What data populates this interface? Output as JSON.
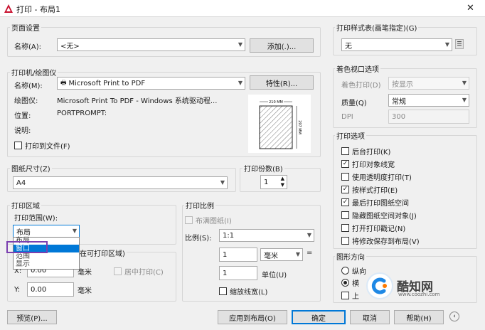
{
  "window": {
    "title": "打印 - 布局1",
    "close": "✕"
  },
  "page_setup": {
    "group_label": "页面设置",
    "name_label": "名称(A):",
    "name_value": "<无>",
    "add_button": "添加(.)..."
  },
  "printer": {
    "group_label": "打印机/绘图仪",
    "name_label": "名称(M):",
    "name_value": "Microsoft Print to PDF",
    "properties_button": "特性(R)...",
    "plotter_label": "绘图仪:",
    "plotter_value": "Microsoft Print To PDF - Windows 系统驱动程...",
    "location_label": "位置:",
    "location_value": "PORTPROMPT:",
    "description_label": "说明:",
    "print_to_file": "打印到文件(F)",
    "preview_width": "210 MM",
    "preview_height": "297 MM"
  },
  "paper_size": {
    "group_label": "图纸尺寸(Z)",
    "value": "A4"
  },
  "copies": {
    "group_label": "打印份数(B)",
    "value": "1"
  },
  "plot_area": {
    "group_label": "打印区域",
    "range_label": "打印范围(W):",
    "range_value": "布局",
    "dropdown_options": [
      "布局",
      "窗口",
      "范围",
      "显示"
    ],
    "selected_option": "窗口"
  },
  "plot_offset": {
    "group_label": "打印偏移(原点设置在可打印区域)",
    "visible_label": "在可打印区域)",
    "x_label": "X:",
    "x_value": "0.00",
    "y_label": "Y:",
    "y_value": "0.00",
    "unit": "毫米",
    "center_label": "居中打印(C)"
  },
  "plot_scale": {
    "group_label": "打印比例",
    "fit_label": "布满图纸(I)",
    "scale_label": "比例(S):",
    "scale_value": "1:1",
    "value1": "1",
    "unit1": "毫米",
    "equals": "=",
    "value2": "1",
    "unit2": "单位(U)",
    "lineweight_label": "缩放线宽(L)"
  },
  "style_table": {
    "group_label": "打印样式表(画笔指定)(G)",
    "value": "无"
  },
  "shaded_viewport": {
    "group_label": "着色视口选项",
    "shade_label": "着色打印(D)",
    "shade_value": "按显示",
    "quality_label": "质量(Q)",
    "quality_value": "常规",
    "dpi_label": "DPI",
    "dpi_value": "300"
  },
  "plot_options": {
    "group_label": "打印选项",
    "items": [
      {
        "label": "后台打印(K)",
        "checked": false
      },
      {
        "label": "打印对象线宽",
        "checked": true
      },
      {
        "label": "使用透明度打印(T)",
        "checked": false
      },
      {
        "label": "按样式打印(E)",
        "checked": true
      },
      {
        "label": "最后打印图纸空间",
        "checked": true
      },
      {
        "label": "隐藏图纸空间对象(J)",
        "checked": false
      },
      {
        "label": "打开打印戳记(N)",
        "checked": false
      },
      {
        "label": "将修改保存到布局(V)",
        "checked": false
      }
    ]
  },
  "orientation": {
    "group_label": "图形方向",
    "portrait": "纵向",
    "landscape": "横",
    "upside_down": "上"
  },
  "footer": {
    "preview_button": "预览(P)...",
    "apply_button": "应用到布局(O)",
    "ok_button": "确定",
    "cancel_button": "取消",
    "help_button": "帮助(H)"
  },
  "watermark": {
    "brand": "酷知网",
    "url": "www.coozhi.com"
  },
  "check_mark": "✓",
  "colors": {
    "accent": "#0078d7",
    "highlight": "#7b3fb0",
    "autocad_red": "#c8102e"
  }
}
